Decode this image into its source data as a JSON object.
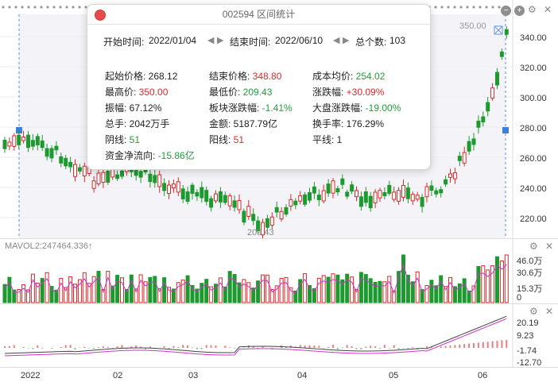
{
  "dialog": {
    "title": "002594 区间统计",
    "start_label": "开始时间:",
    "start_value": "2022/01/04",
    "end_label": "结束时间:",
    "end_value": "2022/06/10",
    "count_label": "总个数:",
    "count_value": "103",
    "stats": [
      {
        "label": "起始价格:",
        "value": "268.12",
        "color": "normal"
      },
      {
        "label": "结束价格:",
        "value": "348.80",
        "color": "red"
      },
      {
        "label": "成本均价:",
        "value": "254.02",
        "color": "green"
      },
      {
        "label": "最高价:",
        "value": "350.00",
        "color": "red"
      },
      {
        "label": "最低价:",
        "value": "209.43",
        "color": "green"
      },
      {
        "label": "涨跌幅:",
        "value": "+30.09%",
        "color": "red"
      },
      {
        "label": "振幅:",
        "value": "67.12%",
        "color": "normal"
      },
      {
        "label": "板块涨跌幅:",
        "value": "-1.41%",
        "color": "green"
      },
      {
        "label": "大盘涨跌幅:",
        "value": "-19.00%",
        "color": "green"
      },
      {
        "label": "总手:",
        "value": "2042万手",
        "color": "normal"
      },
      {
        "label": "金额:",
        "value": "5187.79亿",
        "color": "normal"
      },
      {
        "label": "换手率:",
        "value": "176.29%",
        "color": "normal"
      },
      {
        "label": "阴线:",
        "value": "51",
        "color": "green"
      },
      {
        "label": "阳线:",
        "value": "51",
        "color": "red"
      },
      {
        "label": "平线:",
        "value": "1",
        "color": "normal"
      },
      {
        "label": "资金净流向:",
        "value": "-15.86亿",
        "color": "green"
      }
    ]
  },
  "price_axis": {
    "ticks": [
      "340.00",
      "320.00",
      "300.00",
      "280.00",
      "260.00",
      "240.00",
      "220.00"
    ]
  },
  "price_annotations": {
    "high": "350.00",
    "low": "209.43"
  },
  "volume_pane": {
    "label": "MAVOL2:247464.336↑",
    "ticks": [
      "46.0万",
      "30.6万",
      "15.3万",
      "0"
    ]
  },
  "macd_pane": {
    "ticks": [
      "20.19",
      "9.23",
      "-1.74",
      "-12.70"
    ]
  },
  "x_axis": {
    "ticks": [
      "2022",
      "02",
      "03",
      "04",
      "05",
      "06"
    ]
  },
  "colors": {
    "up": "#d9292b",
    "down": "#1d9a2f",
    "ma": "#cc33cc",
    "macd_line": "#444444"
  }
}
